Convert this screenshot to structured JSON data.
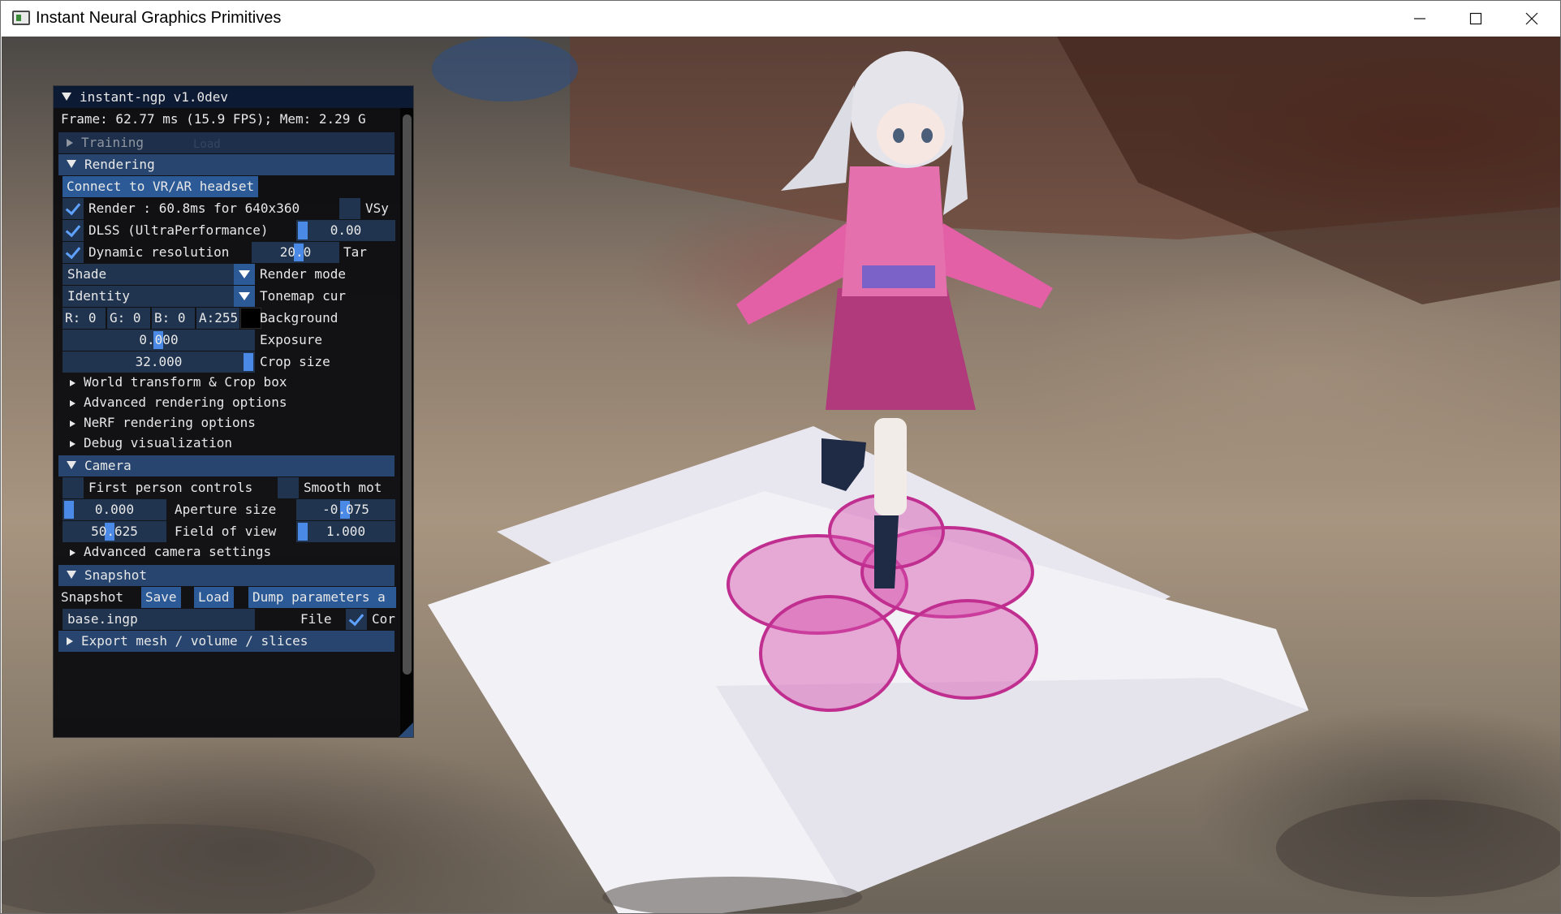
{
  "window": {
    "title": "Instant Neural Graphics Primitives"
  },
  "panel": {
    "title": "instant-ngp v1.0dev",
    "stats": "Frame: 62.77 ms (15.9 FPS); Mem: 2.29 G",
    "training": {
      "label": "Training",
      "ghost_label": "Load"
    },
    "rendering": {
      "label": "Rendering",
      "vr_button": "Connect to VR/AR headset",
      "render_check": "Render : 60.8ms for 640x360",
      "vsync_label": "VSy",
      "dlss_label": "DLSS (UltraPerformance)",
      "dlss_value": "0.00",
      "dynres_label": "Dynamic resolution",
      "dynres_value": "20.0",
      "target_label": "Tar",
      "render_mode_value": "Shade",
      "render_mode_label": "Render mode",
      "tonemap_value": "Identity",
      "tonemap_label": "Tonemap cur",
      "bg_r": "R:  0",
      "bg_g": "G:  0",
      "bg_b": "B:  0",
      "bg_a": "A:255",
      "bg_label": "Background",
      "exposure_value": "0.000",
      "exposure_label": "Exposure",
      "crop_value": "32.000",
      "crop_label": "Crop size",
      "subsections": [
        "World transform & Crop box",
        "Advanced rendering options",
        "NeRF rendering options",
        "Debug visualization"
      ]
    },
    "camera": {
      "label": "Camera",
      "first_person": "First person controls",
      "smooth": "Smooth mot",
      "aperture_value": "0.000",
      "aperture_label": "Aperture size",
      "aperture_right_value": "-0.075",
      "fov_value": "50.625",
      "fov_label": "Field of view",
      "fov_right_value": "1.000",
      "advanced": "Advanced camera settings"
    },
    "snapshot": {
      "label": "Snapshot",
      "row_label": "Snapshot",
      "save": "Save",
      "load": "Load",
      "dump": "Dump parameters a",
      "file_value": "base.ingp",
      "file_label": "File",
      "compress_label": "Cor"
    },
    "export": {
      "label": "Export mesh / volume / slices"
    }
  },
  "colors": {
    "panel_bg": "#0c0c10",
    "section": "#27456e",
    "frame": "#20344f",
    "accent": "#4a8ae6",
    "button": "#2c5a96"
  }
}
